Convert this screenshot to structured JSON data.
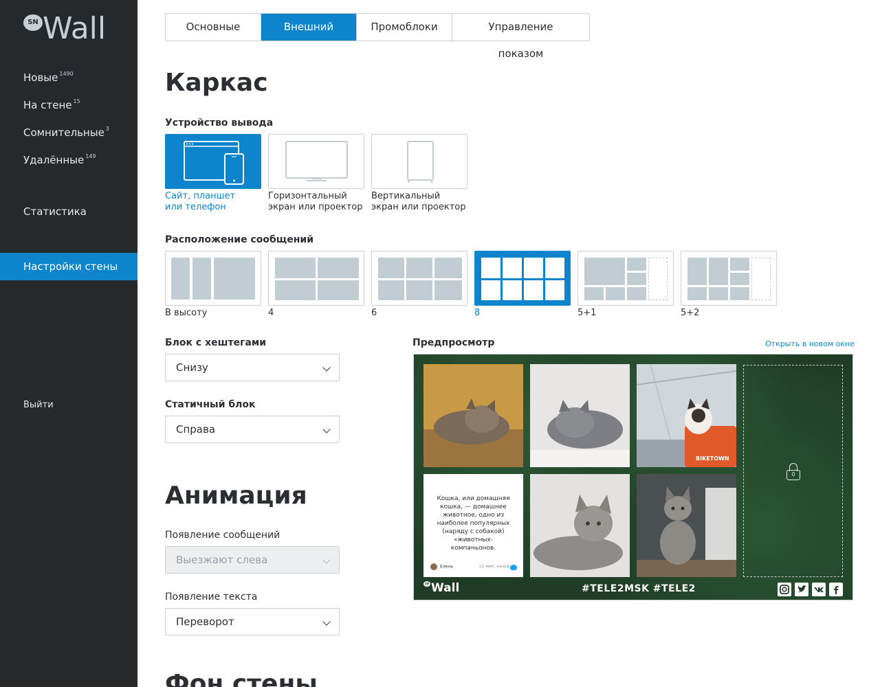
{
  "sidebar": {
    "logo_badge": "SN",
    "logo_text": "Wall",
    "items": [
      {
        "label": "Новые",
        "count": "1490"
      },
      {
        "label": "На стене",
        "count": "15"
      },
      {
        "label": "Сомнительные",
        "count": "3"
      },
      {
        "label": "Удалённые",
        "count": "149"
      }
    ],
    "stats_label": "Статистика",
    "settings_label": "Настройки стены",
    "logout_label": "Выйти"
  },
  "tabs": [
    "Основные",
    "Внешний вид",
    "Промоблоки",
    "Управление показом"
  ],
  "active_tab": 1,
  "frame": {
    "title": "Каркас",
    "device_label": "Устройство вывода",
    "devices": [
      {
        "line1": "Сайт, планшет",
        "line2": "или телефон"
      },
      {
        "line1": "Горизонтальный",
        "line2": "экран или проектор"
      },
      {
        "line1": "Вертикальный",
        "line2": "экран или проектор"
      }
    ],
    "layout_label": "Расположение сообщений",
    "layouts": [
      "В высоту",
      "4",
      "6",
      "8",
      "5+1",
      "5+2"
    ],
    "hashtag_label": "Блок с хештегами",
    "hashtag_value": "Снизу",
    "static_label": "Статичный блок",
    "static_value": "Справа"
  },
  "animation": {
    "title": "Анимация",
    "msg_label": "Появление сообщений",
    "msg_value": "Выезжают слева",
    "text_label": "Появление текста",
    "text_value": "Переворот"
  },
  "background_title": "Фон стены",
  "preview": {
    "label": "Предпросмотр",
    "open_link": "Открыть в новом окне",
    "post_text": "Кошка, или домашняя кошка, — домашнее животное, одно из наиболее популярных (наряду с собакой) «животных-компаньонов.",
    "post_author": "Елена",
    "post_time": "12 мин. назад",
    "lock_number": "0",
    "logo_badge": "SN",
    "logo_text": "Wall",
    "hashtags": "#TELE2MSK  #TELE2",
    "bike_text": "BIKETOWN",
    "social": [
      "instagram-icon",
      "twitter-icon",
      "vk-icon",
      "facebook-icon"
    ]
  },
  "colors": {
    "accent": "#0d84cc",
    "sidebar": "#26292c"
  }
}
